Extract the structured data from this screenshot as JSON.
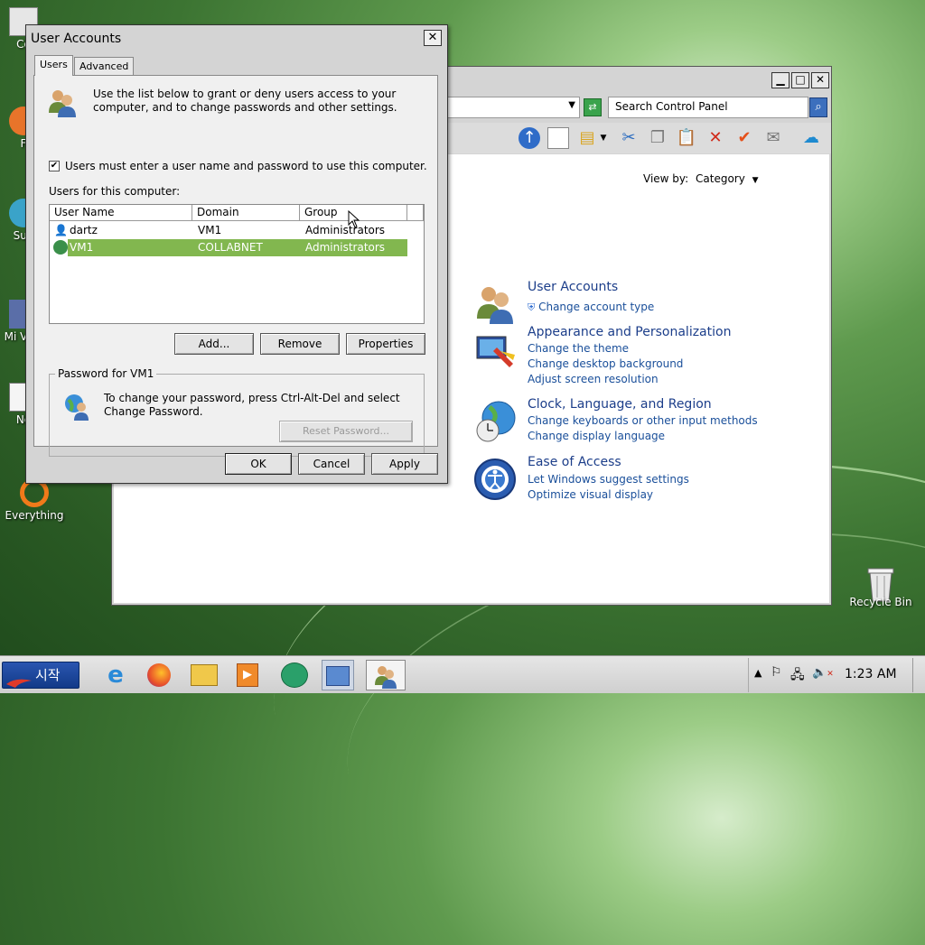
{
  "desktop": {
    "icons": [
      {
        "label": "Co"
      },
      {
        "label": "F"
      },
      {
        "label": "Sup"
      },
      {
        "label": "Mi Visu"
      },
      {
        "label": "No"
      },
      {
        "label": "Everything"
      },
      {
        "label": "Recycle Bin"
      }
    ]
  },
  "control_panel": {
    "search_placeholder": "Search Control Panel",
    "view_by_label": "View by:",
    "view_by_value": "Category",
    "categories": [
      {
        "title": "User Accounts",
        "links": [
          "Change account type"
        ]
      },
      {
        "title": "Appearance and Personalization",
        "links": [
          "Change the theme",
          "Change desktop background",
          "Adjust screen resolution"
        ]
      },
      {
        "title": "Clock, Language, and Region",
        "links": [
          "Change keyboards or other input methods",
          "Change display language"
        ]
      },
      {
        "title": "Ease of Access",
        "links": [
          "Let Windows suggest settings",
          "Optimize visual display"
        ]
      }
    ]
  },
  "dialog": {
    "title": "User Accounts",
    "close_label": "✕",
    "tabs": [
      {
        "label": "Users"
      },
      {
        "label": "Advanced"
      }
    ],
    "intro_text": "Use the list below to grant or deny users access to your computer, and to change passwords and other settings.",
    "checkbox_label": "Users must enter a user name and password to use this computer.",
    "checkbox_checked": true,
    "users_label": "Users for this computer:",
    "columns": [
      "User Name",
      "Domain",
      "Group"
    ],
    "users": [
      {
        "name": "dartz",
        "domain": "VM1",
        "group": "Administrators",
        "selected": false
      },
      {
        "name": "VM1",
        "domain": "COLLABNET",
        "group": "Administrators",
        "selected": true
      }
    ],
    "buttons": {
      "add": "Add...",
      "remove": "Remove",
      "properties": "Properties"
    },
    "password_group_label": "Password for VM1",
    "password_text": "To change your password, press Ctrl-Alt-Del and select Change Password.",
    "reset_password": "Reset Password...",
    "ok": "OK",
    "cancel": "Cancel",
    "apply": "Apply"
  },
  "taskbar": {
    "start_label": "시작",
    "clock": "1:23 AM"
  },
  "colors": {
    "selection": "#82b74f",
    "link": "#1a4f9a",
    "category_title": "#1c3e8a"
  }
}
